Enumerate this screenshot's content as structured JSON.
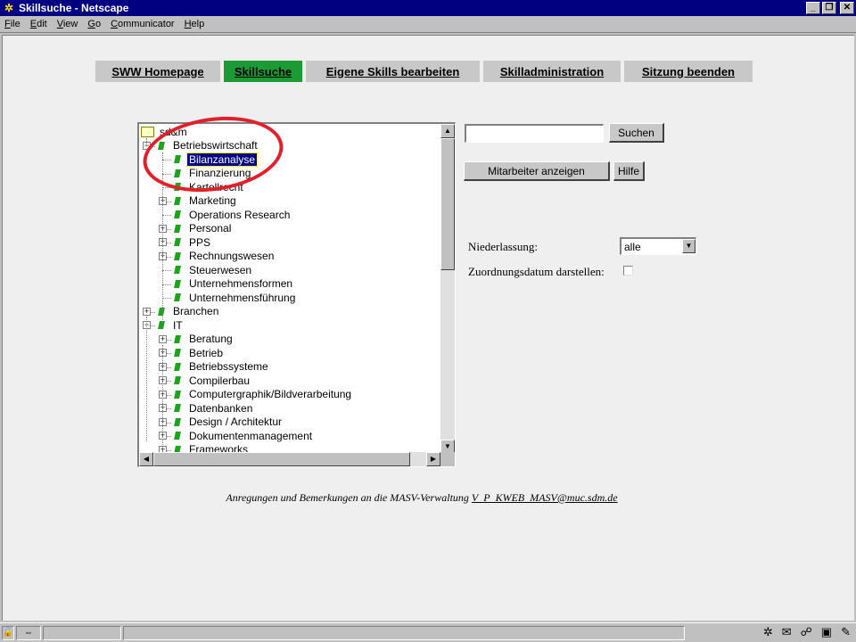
{
  "window": {
    "title": "Skillsuche - Netscape",
    "minimize_glyph": "_",
    "maximize_glyph": "❐",
    "close_glyph": "✕"
  },
  "menu": [
    "File",
    "Edit",
    "View",
    "Go",
    "Communicator",
    "Help"
  ],
  "nav": {
    "tabs": [
      {
        "label": "SWW Homepage",
        "active": false
      },
      {
        "label": "Skillsuche",
        "active": true
      },
      {
        "label": "Eigene Skills bearbeiten",
        "active": false
      },
      {
        "label": "Skilladministration",
        "active": false
      },
      {
        "label": "Sitzung beenden",
        "active": false
      }
    ]
  },
  "tree": {
    "root": "sd&m",
    "selected": "Bilanzanalyse",
    "nodes": [
      {
        "label": "sd&m",
        "level": 0,
        "type": "folder",
        "expander": ""
      },
      {
        "label": "Betriebswirtschaft",
        "level": 1,
        "type": "leaf",
        "expander": "−"
      },
      {
        "label": "Bilanzanalyse",
        "level": 2,
        "type": "leaf",
        "expander": ""
      },
      {
        "label": "Finanzierung",
        "level": 2,
        "type": "leaf",
        "expander": ""
      },
      {
        "label": "Kartellrecht",
        "level": 2,
        "type": "leaf",
        "expander": ""
      },
      {
        "label": "Marketing",
        "level": 2,
        "type": "leaf",
        "expander": "+"
      },
      {
        "label": "Operations Research",
        "level": 2,
        "type": "leaf",
        "expander": ""
      },
      {
        "label": "Personal",
        "level": 2,
        "type": "leaf",
        "expander": "+"
      },
      {
        "label": "PPS",
        "level": 2,
        "type": "leaf",
        "expander": "+"
      },
      {
        "label": "Rechnungswesen",
        "level": 2,
        "type": "leaf",
        "expander": "+"
      },
      {
        "label": "Steuerwesen",
        "level": 2,
        "type": "leaf",
        "expander": ""
      },
      {
        "label": "Unternehmensformen",
        "level": 2,
        "type": "leaf",
        "expander": ""
      },
      {
        "label": "Unternehmensführung",
        "level": 2,
        "type": "leaf",
        "expander": ""
      },
      {
        "label": "Branchen",
        "level": 1,
        "type": "leaf",
        "expander": "+"
      },
      {
        "label": "IT",
        "level": 1,
        "type": "leaf",
        "expander": "−"
      },
      {
        "label": "Beratung",
        "level": 2,
        "type": "leaf",
        "expander": "+"
      },
      {
        "label": "Betrieb",
        "level": 2,
        "type": "leaf",
        "expander": "+"
      },
      {
        "label": "Betriebssysteme",
        "level": 2,
        "type": "leaf",
        "expander": "+"
      },
      {
        "label": "Compilerbau",
        "level": 2,
        "type": "leaf",
        "expander": "+"
      },
      {
        "label": "Computergraphik/Bildverarbeitung",
        "level": 2,
        "type": "leaf",
        "expander": "+"
      },
      {
        "label": "Datenbanken",
        "level": 2,
        "type": "leaf",
        "expander": "+"
      },
      {
        "label": "Design / Architektur",
        "level": 2,
        "type": "leaf",
        "expander": "+"
      },
      {
        "label": "Dokumentenmanagement",
        "level": 2,
        "type": "leaf",
        "expander": "+"
      },
      {
        "label": "Frameworks",
        "level": 2,
        "type": "leaf",
        "expander": "+"
      }
    ]
  },
  "search": {
    "value": "",
    "button": "Suchen"
  },
  "actions": {
    "show_employees": "Mitarbeiter anzeigen",
    "help": "Hilfe"
  },
  "filters": {
    "niederlassung_label": "Niederlassung:",
    "niederlassung_value": "alle",
    "zuordnungsdatum_label": "Zuordnungsdatum darstellen:",
    "zuordnungsdatum_checked": false
  },
  "footer": {
    "text": "Anregungen und Bemerkungen an die MASV-Verwaltung",
    "link": "V_P_KWEB_MASV@muc.sdm.de"
  },
  "colors": {
    "active_tab": "#1c9a33",
    "selection": "#000080",
    "annotation": "#e0202a"
  }
}
